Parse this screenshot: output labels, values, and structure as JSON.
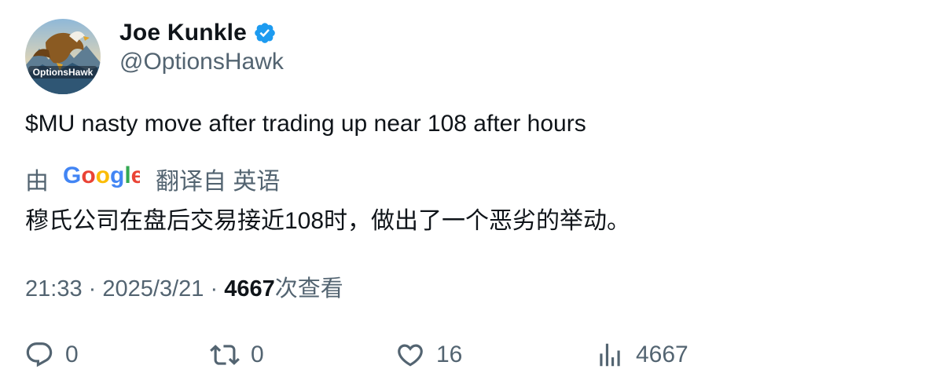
{
  "author": {
    "display_name": "Joe Kunkle",
    "handle": "@OptionsHawk",
    "avatar_text": "OptionsHawk"
  },
  "tweet": {
    "text": "$MU nasty move after trading up near 108 after hours"
  },
  "translation": {
    "prefix": "由",
    "provider_label": "Google",
    "suffix": "翻译自 英语",
    "text": "穆氏公司在盘后交易接近108时，做出了一个恶劣的举动。"
  },
  "meta": {
    "time": "21:33",
    "separator": "·",
    "date": "2025/3/21",
    "views_count": "4667",
    "views_label": "次查看"
  },
  "actions": {
    "replies": "0",
    "retweets": "0",
    "likes": "16",
    "views": "4667"
  },
  "colors": {
    "text_primary": "#0f1419",
    "text_secondary": "#536471",
    "verified": "#1d9bf0"
  }
}
